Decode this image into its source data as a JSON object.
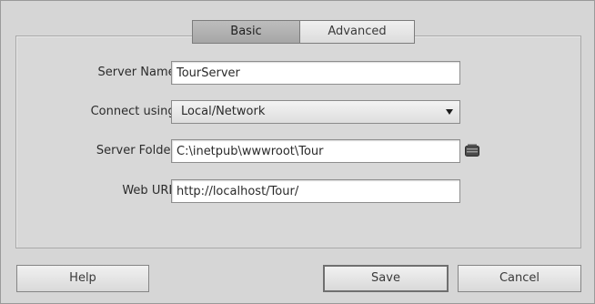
{
  "tabs": {
    "basic": "Basic",
    "advanced": "Advanced"
  },
  "form": {
    "server_name_label": "Server Name:",
    "server_name_value": "TourServer",
    "connect_label": "Connect using:",
    "connect_value": "Local/Network",
    "server_folder_label": "Server Folder:",
    "server_folder_value": "C:\\inetpub\\wwwroot\\Tour",
    "web_url_label": "Web URL:",
    "web_url_value": "http://localhost/Tour/"
  },
  "icons": {
    "browse": "folder-icon",
    "dropdown": "chevron-down-icon"
  },
  "buttons": {
    "help": "Help",
    "save": "Save",
    "cancel": "Cancel"
  }
}
